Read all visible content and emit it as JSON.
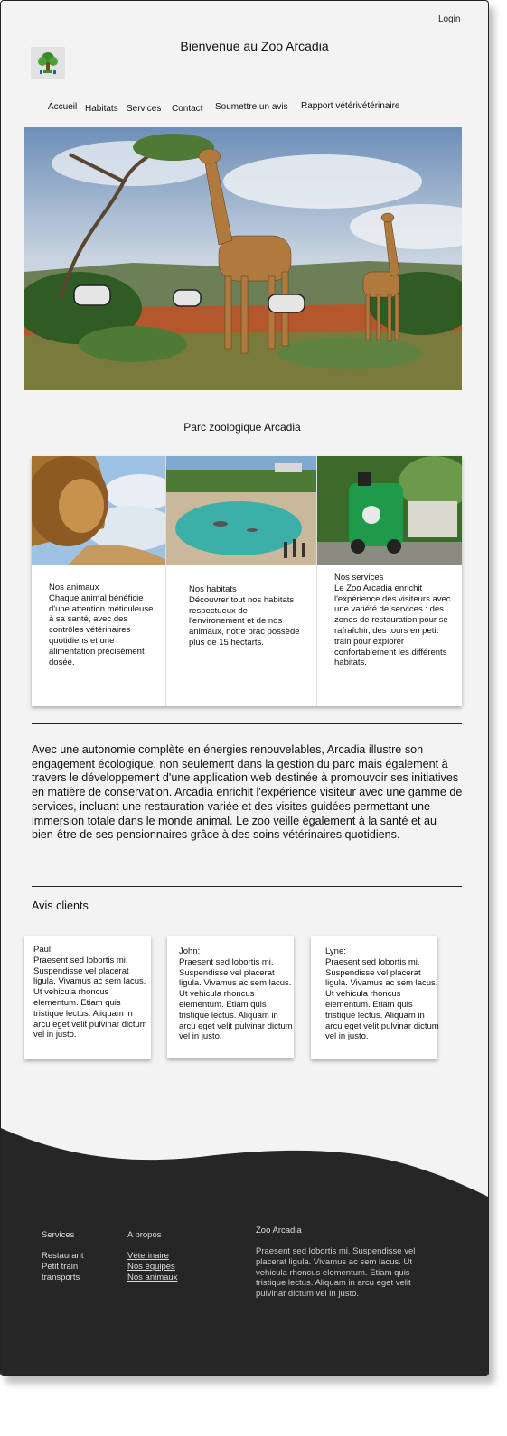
{
  "header": {
    "login_label": "Login",
    "title": "Bienvenue au Zoo Arcadia",
    "logo_icon": "tree-logo-icon"
  },
  "nav": {
    "items": [
      {
        "label": "Accueil"
      },
      {
        "label": "Habitats"
      },
      {
        "label": "Services"
      },
      {
        "label": "Contact"
      },
      {
        "label": "Soumettre un avis"
      },
      {
        "label": "Rapport vétérivétérinaire"
      }
    ]
  },
  "hero": {
    "image": "giraffes-savanna-image"
  },
  "park": {
    "title": "Parc zoologique Arcadia"
  },
  "cards": [
    {
      "image": "lion-image",
      "title": "Nos animaux",
      "text": "Chaque animal bénéficie d'une attention méticuleuse à sa santé, avec des contrôles vétérinaires quotidiens et une alimentation précisément dosée."
    },
    {
      "image": "habitat-pool-image",
      "title": "Nos habitats",
      "text": "Découvrer tout nos habitats respectueux de l'environement et de nos animaux, notre prac possède plus de 15 hectarts."
    },
    {
      "image": "green-train-image",
      "title": "Nos services",
      "text": "Le Zoo Arcadia enrichit l'expérience des visiteurs avec une variété de services : des zones de restauration pour se rafraîchir, des tours en petit train pour explorer confortablement les différents habitats."
    }
  ],
  "about": {
    "text": "Avec une autonomie complète en énergies renouvelables, Arcadia illustre son engagement écologique, non seulement dans la gestion du parc mais également à travers le développement d'une application web destinée à promouvoir ses initiatives en matière de conservation. Arcadia enrichit l'expérience visiteur avec une gamme de services, incluant une restauration variée et des visites guidées permettant une immersion totale dans le monde animal. Le zoo veille également à la santé et au bien-être de ses pensionnaires grâce à des soins vétérinaires quotidiens."
  },
  "reviews": {
    "title": "Avis clients",
    "items": [
      {
        "author": "Paul:",
        "text": "Praesent sed lobortis mi. Suspendisse vel placerat ligula. Vivamus ac sem lacus. Ut vehicula rhoncus elementum. Etiam quis tristique lectus. Aliquam in arcu eget velit pulvinar dictum vel in justo."
      },
      {
        "author": "John:",
        "text": "Praesent sed lobortis mi. Suspendisse vel placerat ligula. Vivamus ac sem lacus. Ut vehicula rhoncus elementum. Etiam quis tristique lectus. Aliquam in arcu eget velit pulvinar dictum vel in justo."
      },
      {
        "author": "Lyne:",
        "text": "Praesent sed lobortis mi. Suspendisse vel placerat ligula. Vivamus ac sem lacus. Ut vehicula rhoncus elementum. Etiam quis tristique lectus. Aliquam in arcu eget velit pulvinar dictum vel in justo."
      }
    ]
  },
  "footer": {
    "services": {
      "title": "Services",
      "items": [
        "Restaurant",
        "Petit train",
        "transports"
      ]
    },
    "apropos": {
      "title": "A propos",
      "items": [
        "Véterinaire",
        "Nos équipes",
        "Nos animaux"
      ]
    },
    "zoo": {
      "title": "Zoo Arcadia",
      "text": "Praesent sed lobortis mi. Suspendisse vel placerat ligula. Vivamus ac sem lacus. Ut vehicula rhoncus elementum. Etiam quis tristique lectus. Aliquam in arcu eget velit pulvinar dictum vel in justo."
    }
  },
  "colors": {
    "page_bg": "#f3f3f3",
    "footer_bg": "#262626",
    "text": "#111111"
  }
}
